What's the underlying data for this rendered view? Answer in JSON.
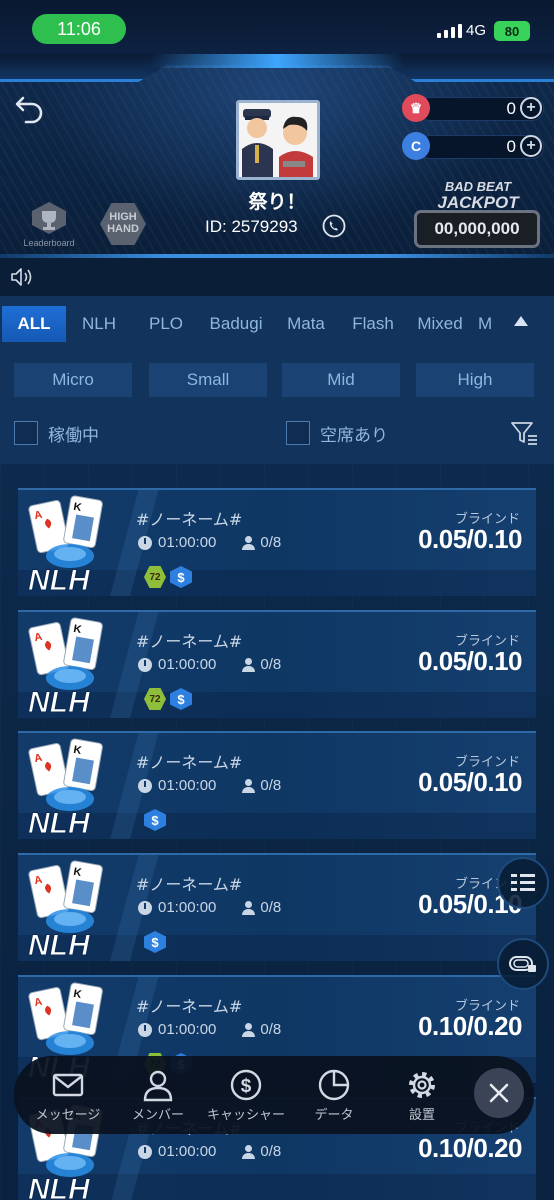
{
  "status_bar": {
    "time": "11:06",
    "network": "4G",
    "battery": "80"
  },
  "header": {
    "player_name": "祭り！",
    "player_id": "ID: 2579293",
    "currencies": [
      {
        "icon": "crown-chip-icon",
        "value": "0",
        "color": "#e04a5a"
      },
      {
        "icon": "c-coin-icon",
        "value": "0",
        "color": "#3d7fe0"
      }
    ],
    "leaderboard_label": "Leaderboard",
    "high_hand_label": "HIGH HAND",
    "jackpot": {
      "title_line1": "BAD BEAT",
      "title_line2": "JACKPOT",
      "value": "00,000,000"
    }
  },
  "tabs": [
    {
      "label": "ALL",
      "active": true
    },
    {
      "label": "NLH",
      "active": false
    },
    {
      "label": "PLO",
      "active": false
    },
    {
      "label": "Badugi",
      "active": false
    },
    {
      "label": "Mata",
      "active": false
    },
    {
      "label": "Flash",
      "active": false
    },
    {
      "label": "Mixed",
      "active": false
    },
    {
      "label": "M",
      "active": false
    }
  ],
  "stakes": [
    "Micro",
    "Small",
    "Mid",
    "High"
  ],
  "checkboxes": {
    "running": "稼働中",
    "seats_open": "空席あり"
  },
  "tables": [
    {
      "name": "#ノーネーム#",
      "time": "01:00:00",
      "players": "0/8",
      "blind_label": "ブラインド",
      "blinds": "0.05/0.10",
      "game": "NLH",
      "badges": [
        "72",
        "$"
      ]
    },
    {
      "name": "#ノーネーム#",
      "time": "01:00:00",
      "players": "0/8",
      "blind_label": "ブラインド",
      "blinds": "0.05/0.10",
      "game": "NLH",
      "badges": [
        "72",
        "$"
      ]
    },
    {
      "name": "#ノーネーム#",
      "time": "01:00:00",
      "players": "0/8",
      "blind_label": "ブラインド",
      "blinds": "0.05/0.10",
      "game": "NLH",
      "badges": [
        "$"
      ]
    },
    {
      "name": "#ノーネーム#",
      "time": "01:00:00",
      "players": "0/8",
      "blind_label": "ブラインド",
      "blinds": "0.05/0.10",
      "game": "NLH",
      "badges": [
        "$"
      ]
    },
    {
      "name": "#ノーネーム#",
      "time": "01:00:00",
      "players": "0/8",
      "blind_label": "ブラインド",
      "blinds": "0.10/0.20",
      "game": "NLH",
      "badges": [
        "72",
        "$"
      ]
    },
    {
      "name": "#ノーネーム#",
      "time": "01:00:00",
      "players": "0/8",
      "blind_label": "ブラインド",
      "blinds": "0.10/0.20",
      "game": "NLH",
      "badges": []
    }
  ],
  "bottom_nav": [
    {
      "label": "メッセージ",
      "icon": "envelope-icon"
    },
    {
      "label": "メンバー",
      "icon": "member-icon"
    },
    {
      "label": "キャッシャー",
      "icon": "cashier-icon"
    },
    {
      "label": "データ",
      "icon": "chart-icon"
    },
    {
      "label": "設置",
      "icon": "gear-icon"
    }
  ],
  "colors": {
    "accent": "#1f6fd6",
    "background": "#0b2340",
    "status_green": "#2fbf4f"
  }
}
